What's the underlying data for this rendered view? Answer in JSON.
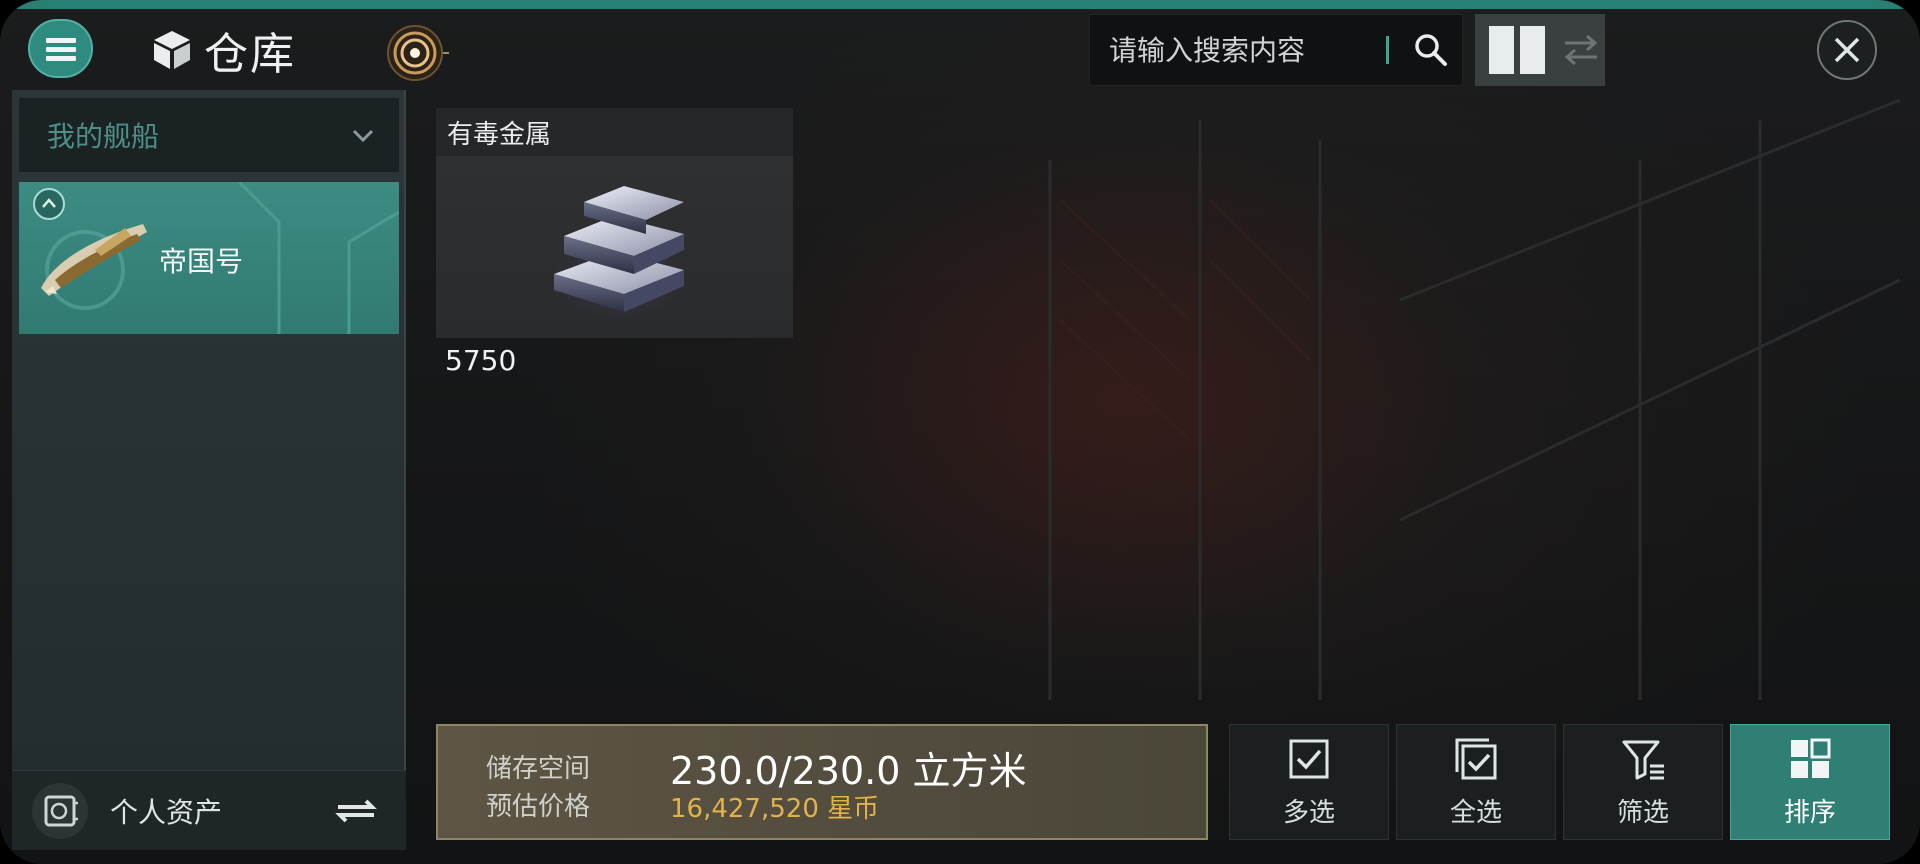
{
  "colors": {
    "accent_teal": "#2f8a7f",
    "gold_text": "#e3b24a",
    "selected_teal": "#317a72"
  },
  "header": {
    "title": "仓库",
    "search": {
      "placeholder": "请输入搜索内容"
    }
  },
  "sidebar": {
    "dropdown_label": "我的舰船",
    "ships": [
      {
        "name": "帝国号",
        "selected": true
      }
    ],
    "assets_label": "个人资产"
  },
  "items": [
    {
      "name": "有毒金属",
      "quantity": "5750"
    }
  ],
  "storage": {
    "space_label": "储存空间",
    "space_value": "230.0/230.0 立方米",
    "price_label": "预估价格",
    "price_value": "16,427,520 星币"
  },
  "actions": {
    "multi_select": "多选",
    "select_all": "全选",
    "filter": "筛选",
    "sort": "排序"
  }
}
